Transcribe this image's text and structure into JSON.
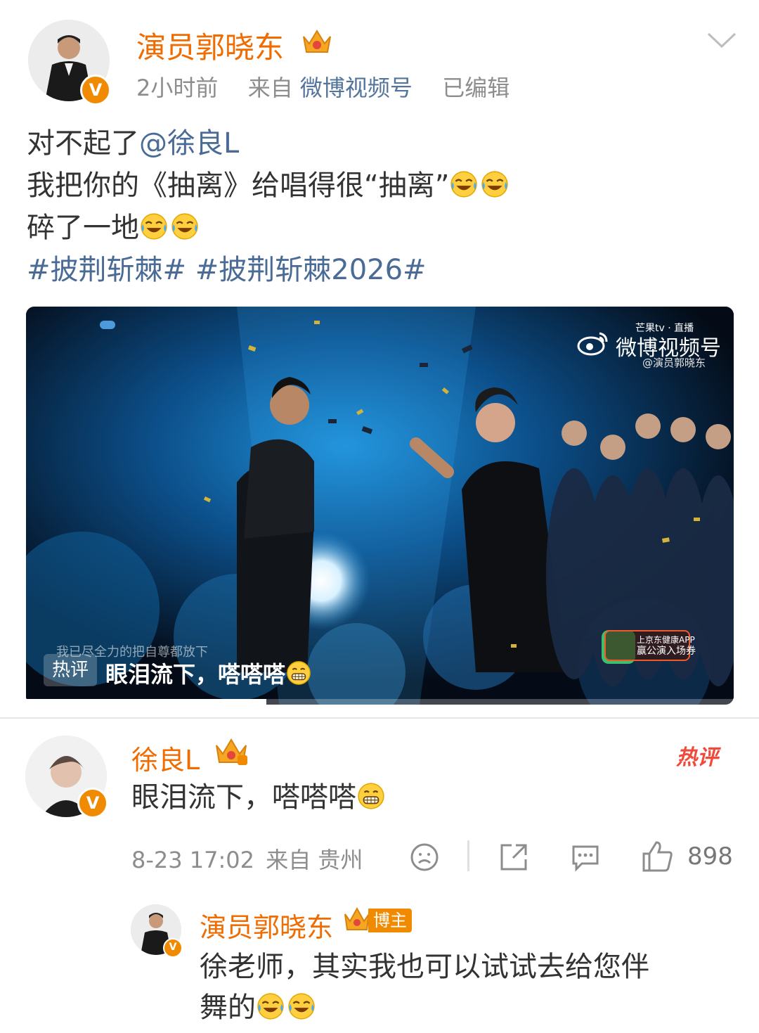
{
  "post": {
    "author": "演员郭晓东",
    "time": "2小时前",
    "from_label": "来自",
    "source": "微博视频号",
    "edited": "已编辑",
    "line1_text": "对不起了",
    "line1_mention": "@徐良L",
    "line2": "我把你的《抽离》给唱得很“抽离”",
    "line3": "碎了一地",
    "hashtag1": "#披荆斩棘#",
    "hashtag2": "#披荆斩棘2026#",
    "emoji": "laugh-cry-emoji"
  },
  "video": {
    "watermark_title": "微博视频号",
    "watermark_mango": "芒果tv · 直播",
    "watermark_user": "@演员郭晓东",
    "lyric": "我已尽全力的把自尊都放下",
    "hot_tag": "热评",
    "hot_comment": "眼泪流下，嗒嗒嗒",
    "ad_line1": "上京东健康APP",
    "ad_line2": "赢公演入场券",
    "progress": 0.34
  },
  "comment": {
    "author": "徐良L",
    "hot_mark": "热评",
    "text": "眼泪流下，嗒嗒嗒",
    "date": "8-23 17:02",
    "from_label": "来自",
    "location": "贵州",
    "likes": "898"
  },
  "reply": {
    "author": "演员郭晓东",
    "blogger_tag": "博主",
    "line1": "徐老师，其实我也可以试试去给您伴",
    "line2": "舞的"
  },
  "colors": {
    "name_orange": "#f06b00",
    "link_blue": "#4a6b95",
    "meta_gray": "#8d8d8d",
    "verified_orange": "#f08a00",
    "hot_red": "#f04a3c"
  }
}
